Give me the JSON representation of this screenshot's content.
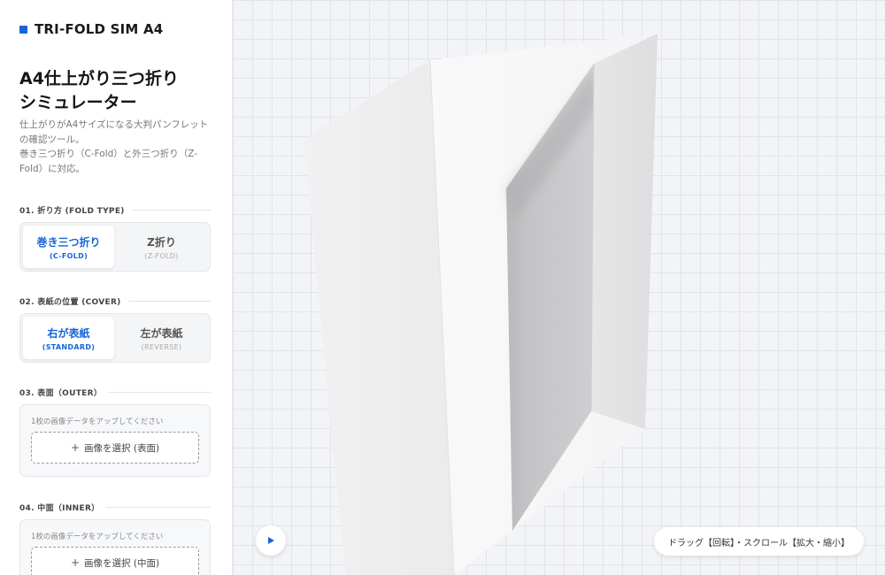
{
  "brand": {
    "name": "TRI-FOLD SIM A4",
    "accent": "#1565d8"
  },
  "header": {
    "title_line1": "A4仕上がり三つ折り",
    "title_line2": "シミュレーター",
    "desc_line1": "仕上がりがA4サイズになる大判パンフレット",
    "desc_line2": "の確認ツール。",
    "desc_line3": "巻き三つ折り（C-Fold）と外三つ折り（Z-",
    "desc_line4": "Fold）に対応。"
  },
  "fold_type": {
    "label": "01. 折り方 (FOLD TYPE)",
    "options": [
      {
        "main": "巻き三つ折り",
        "sub": "(C-FOLD)",
        "active": true
      },
      {
        "main": "Z折り",
        "sub": "(Z-FOLD)",
        "active": false
      }
    ]
  },
  "cover": {
    "label": "02. 表紙の位置 (COVER)",
    "options": [
      {
        "main": "右が表紙",
        "sub": "(STANDARD)",
        "active": true
      },
      {
        "main": "左が表紙",
        "sub": "(REVERSE)",
        "active": false
      }
    ]
  },
  "outer": {
    "label": "03. 表面（OUTER）",
    "hint": "1枚の画像データをアップしてください",
    "button": "画像を選択 (表面)"
  },
  "inner": {
    "label": "04. 中面（INNER）",
    "hint": "1枚の画像データをアップしてください",
    "button": "画像を選択 (中面)"
  },
  "viewport": {
    "hint": "ドラッグ【回転】・スクロール【拡大・縮小】",
    "play_icon": "play-icon"
  }
}
